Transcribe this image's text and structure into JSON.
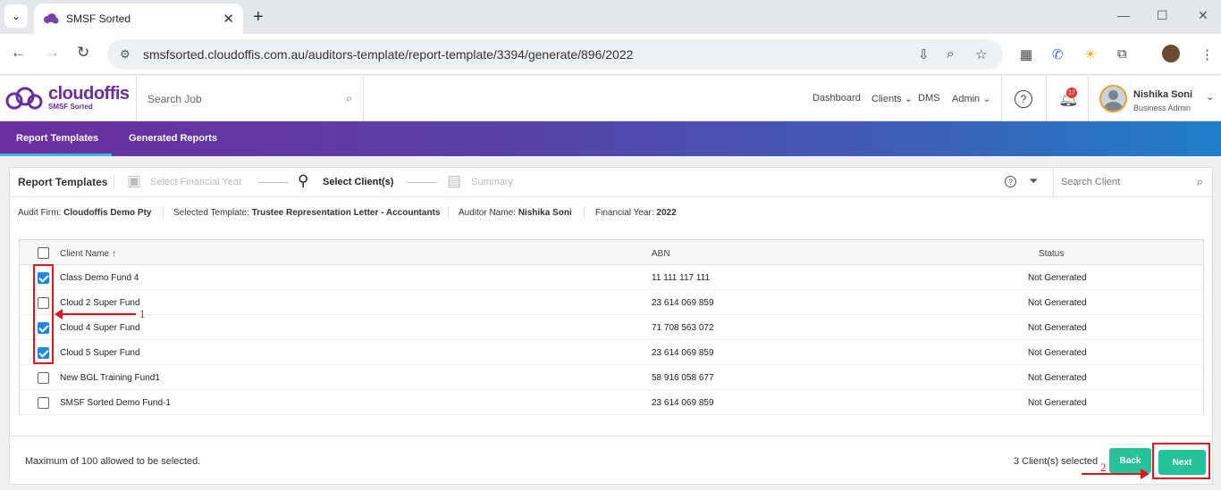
{
  "browser": {
    "tab_title": "SMSF Sorted",
    "url": "smsfsorted.cloudoffis.com.au/auditors-template/report-template/3394/generate/896/2022"
  },
  "header": {
    "brand": "cloudoffis",
    "brand_sub": "SMSF Sorted",
    "search_placeholder": "Search Job",
    "nav": [
      "Dashboard",
      "Clients",
      "DMS",
      "Admin"
    ],
    "notif_count": "17",
    "user_name": "Nishika Soni",
    "user_role": "Business Admin"
  },
  "subnav": {
    "tabs": [
      "Report Templates",
      "Generated Reports"
    ]
  },
  "panel": {
    "title": "Report Templates",
    "steps": [
      "Select Financial Year",
      "Select Client(s)",
      "Summary"
    ],
    "search_placeholder": "Search Client",
    "info": {
      "audit_firm_label": "Audit Firm:",
      "audit_firm": "Cloudoffis Demo Pty",
      "template_label": "Selected Template:",
      "template": "Trustee Representation Letter - Accountants",
      "auditor_label": "Auditor Name:",
      "auditor": "Nishika Soni",
      "fy_label": "Financial Year:",
      "fy": "2022"
    },
    "columns": [
      "Client Name",
      "ABN",
      "Status"
    ],
    "rows": [
      {
        "name": "Class Demo Fund 4",
        "abn": "11 111 117 111",
        "status": "Not Generated",
        "checked": true
      },
      {
        "name": "Cloud 2 Super Fund",
        "abn": "23 614 069 859",
        "status": "Not Generated",
        "checked": false
      },
      {
        "name": "Cloud 4 Super Fund",
        "abn": "71 708 563 072",
        "status": "Not Generated",
        "checked": true
      },
      {
        "name": "Cloud 5 Super Fund",
        "abn": "23 614 069 859",
        "status": "Not Generated",
        "checked": true
      },
      {
        "name": "New BGL Training Fund1",
        "abn": "58 916 058 677",
        "status": "Not Generated",
        "checked": false
      },
      {
        "name": "SMSF Sorted Demo Fund-1",
        "abn": "23 614 069 859",
        "status": "Not Generated",
        "checked": false
      }
    ],
    "max_note": "Maximum of 100 allowed to be selected.",
    "selected_count": "3 Client(s) selected",
    "back_label": "Back",
    "next_label": "Next"
  },
  "annotations": [
    "1",
    "2"
  ],
  "colors": {
    "accent": "#26c29a",
    "brand": "#6a2d9f",
    "annotation": "#e0141e",
    "checkbox": "#1e88e5"
  }
}
